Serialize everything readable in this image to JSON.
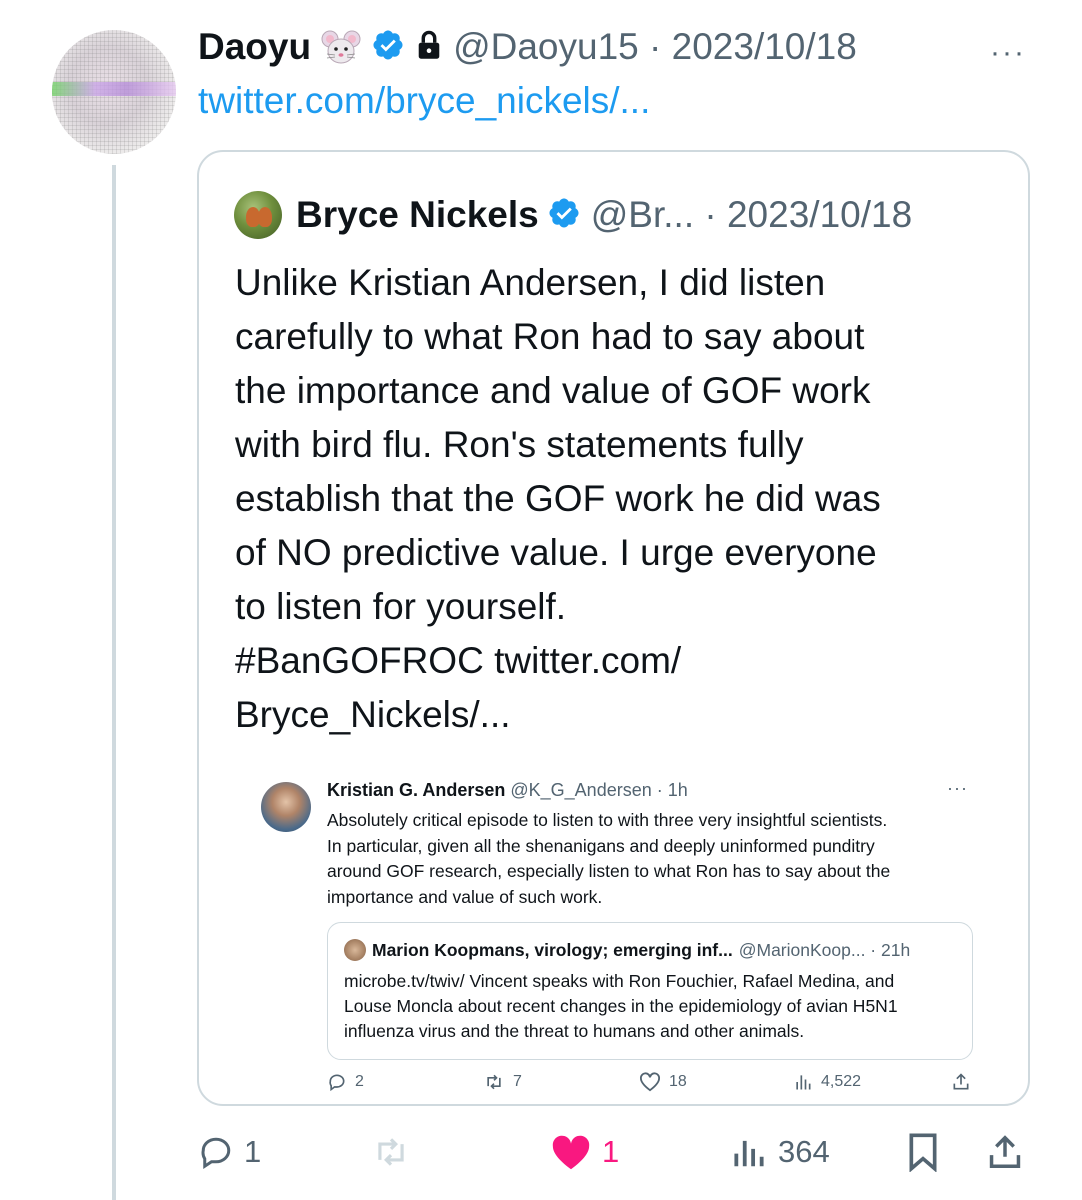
{
  "tweet": {
    "author_name": "Daoyu",
    "author_emoji": "🐭",
    "author_handle_time": "@Daoyu15 · 2023/10/18",
    "more_label": "···",
    "link_text": "twitter.com/bryce_nickels/..."
  },
  "quote": {
    "author_name": "Bryce Nickels",
    "author_handle_time": "@Br... · 2023/10/18",
    "text_lines": [
      "Unlike Kristian Andersen, I did listen",
      "carefully to what Ron had to say about",
      "the importance and value of GOF work",
      "with bird flu. Ron's statements fully",
      "establish that the GOF work he did was",
      "of NO predictive value. I urge everyone",
      "to listen for yourself.",
      "#BanGOFROC twitter.com/",
      "Bryce_Nickels/..."
    ]
  },
  "embedded": {
    "author_name": "Kristian G. Andersen",
    "author_handle_time": " @K_G_Andersen · 1h",
    "more_label": "···",
    "text_lines": [
      "Absolutely critical episode to listen to with three very insightful scientists.",
      "In particular, given all the shenanigans and deeply uninformed punditry",
      "around GOF research, especially listen to what Ron has to say about the",
      "importance and value of such work."
    ],
    "inner": {
      "author_name": "Marion Koopmans, virology; emerging inf...",
      "author_handle_time": "@MarionKoop... · 21h",
      "text_lines": [
        "microbe.tv/twiv/ Vincent speaks with Ron Fouchier, Rafael Medina, and",
        "Louse Moncla about recent changes in the epidemiology of avian H5N1",
        "influenza virus and the threat to humans and other animals."
      ]
    },
    "actions": {
      "replies": "2",
      "retweets": "7",
      "likes": "18",
      "views": "4,522"
    }
  },
  "actions": {
    "replies": "1",
    "likes": "1",
    "views": "364"
  },
  "colors": {
    "verified": "#1d9bf0",
    "link": "#1d9bf0",
    "like": "#f91880",
    "secondary": "#536471"
  }
}
